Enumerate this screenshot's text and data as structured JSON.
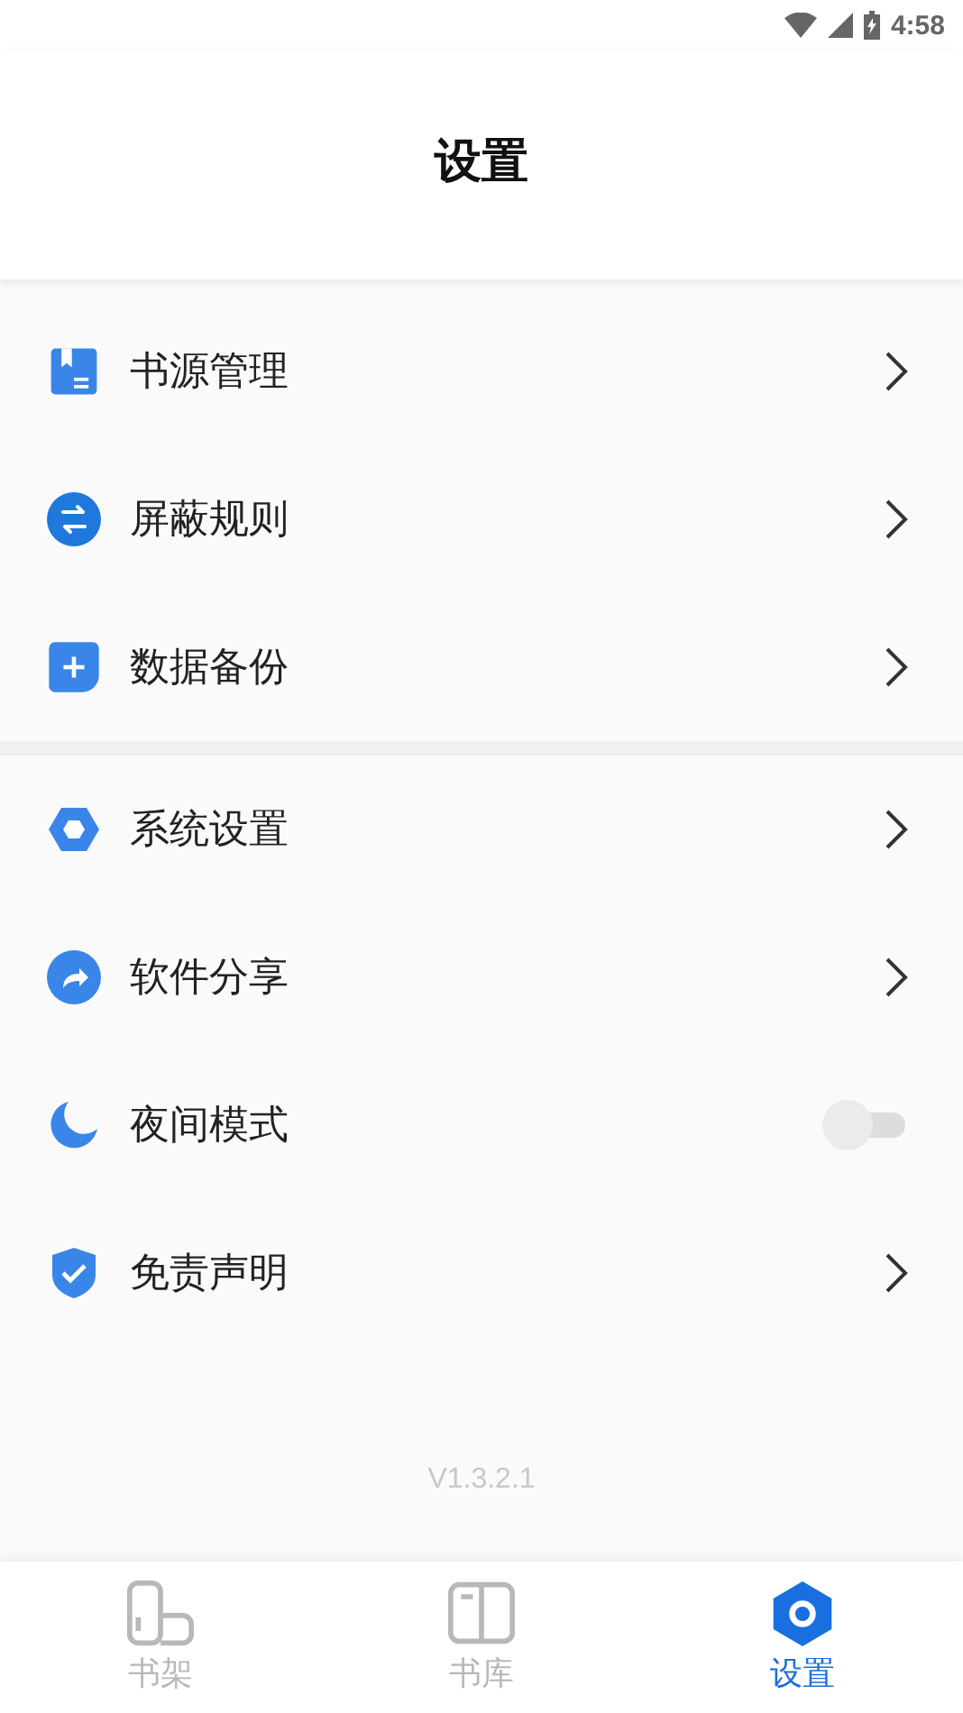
{
  "status_bar": {
    "time": "4:58"
  },
  "header": {
    "title": "设置"
  },
  "groups": [
    {
      "items": [
        {
          "label": "书源管理",
          "kind": "arrow"
        },
        {
          "label": "屏蔽规则",
          "kind": "arrow"
        },
        {
          "label": "数据备份",
          "kind": "arrow"
        }
      ]
    },
    {
      "items": [
        {
          "label": "系统设置",
          "kind": "arrow"
        },
        {
          "label": "软件分享",
          "kind": "arrow"
        },
        {
          "label": "夜间模式",
          "kind": "toggle",
          "on": false
        },
        {
          "label": "免责声明",
          "kind": "arrow"
        }
      ]
    }
  ],
  "version": "V1.3.2.1",
  "bottom_nav": [
    {
      "label": "书架",
      "selected": false
    },
    {
      "label": "书库",
      "selected": false
    },
    {
      "label": "设置",
      "selected": true
    }
  ]
}
